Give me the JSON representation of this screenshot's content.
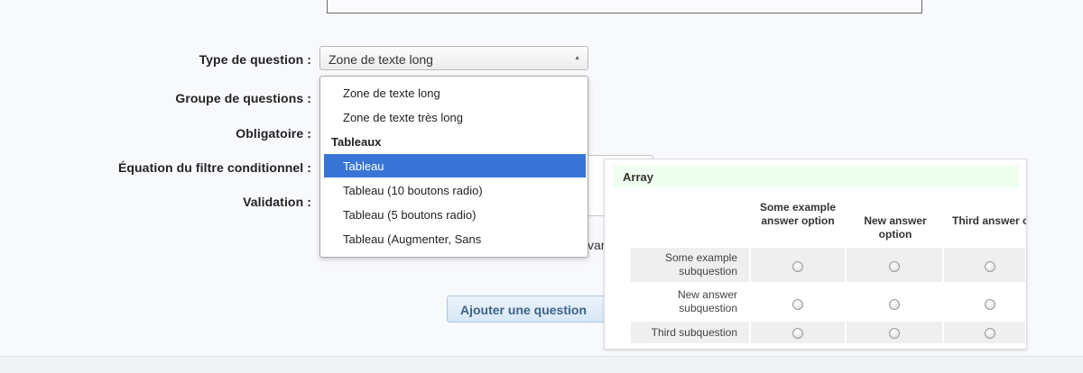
{
  "form": {
    "labels": {
      "type": "Type de question :",
      "group": "Groupe de questions :",
      "mandatory": "Obligatoire :",
      "relevance": "Équation du filtre conditionnel :",
      "validation": "Validation :"
    },
    "select_value": "Zone de texte long",
    "cut_text": "var",
    "add_button": "Ajouter une question"
  },
  "dropdown": {
    "items": [
      {
        "label": "Zone de texte long",
        "type": "option"
      },
      {
        "label": "Zone de texte très long",
        "type": "option"
      },
      {
        "label": "Tableaux",
        "type": "group"
      },
      {
        "label": "Tableau",
        "type": "option",
        "selected": true
      },
      {
        "label": "Tableau (10 boutons radio)",
        "type": "option"
      },
      {
        "label": "Tableau (5 boutons radio)",
        "type": "option"
      },
      {
        "label": "Tableau (Augmenter, Sans",
        "type": "option"
      }
    ],
    "selected_color": "#3875d7"
  },
  "preview": {
    "title": "Array",
    "columns": [
      "Some example answer option",
      "New answer option",
      "Third answer option"
    ],
    "rows": [
      "Some example subquestion",
      "New answer subquestion",
      "Third subquestion"
    ],
    "title_bg": "#efffef"
  }
}
